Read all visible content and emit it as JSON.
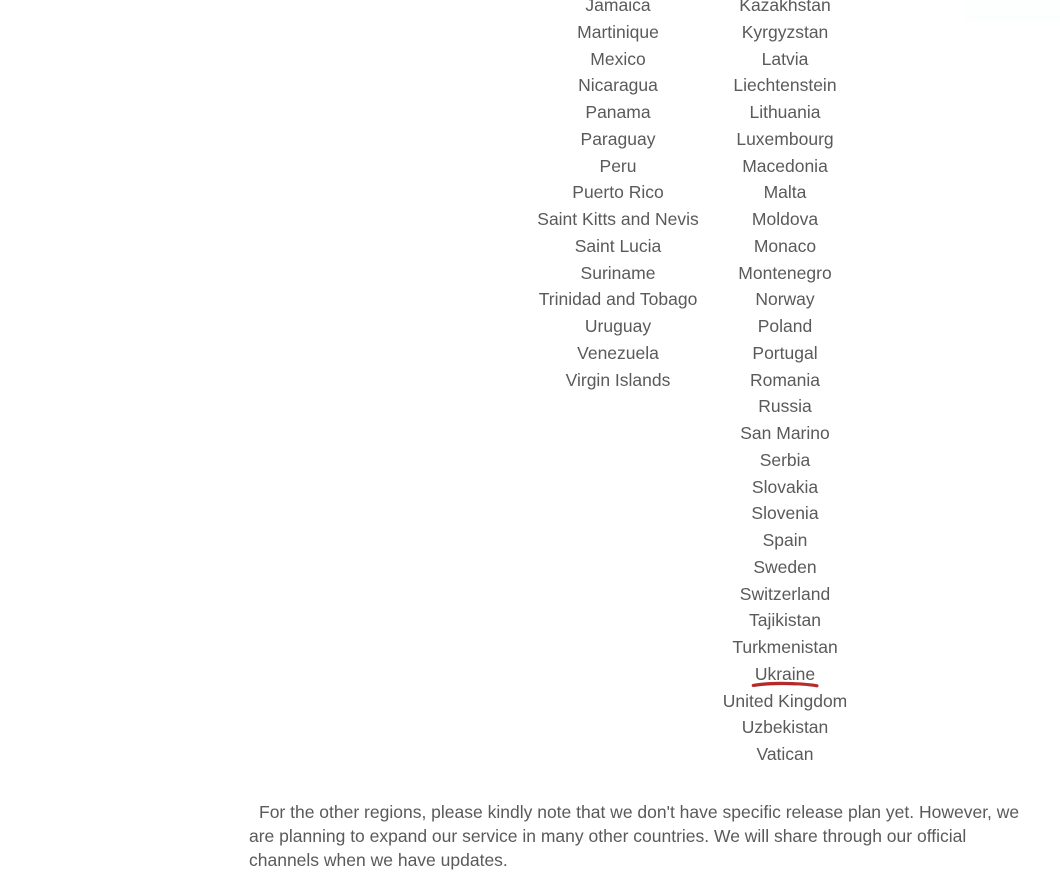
{
  "colors": {
    "text": "#5a5a5a",
    "background": "#ffffff",
    "marker_red": "#b22222"
  },
  "country_list": {
    "left_column": [
      "Jamaica",
      "Martinique",
      "Mexico",
      "Nicaragua",
      "Panama",
      "Paraguay",
      "Peru",
      "Puerto Rico",
      "Saint Kitts and Nevis",
      "Saint Lucia",
      "Suriname",
      "Trinidad and Tobago",
      "Uruguay",
      "Venezuela",
      "Virgin Islands"
    ],
    "right_column": [
      "Kazakhstan",
      "Kyrgyzstan",
      "Latvia",
      "Liechtenstein",
      "Lithuania",
      "Luxembourg",
      "Macedonia",
      "Malta",
      "Moldova",
      "Monaco",
      "Montenegro",
      "Norway",
      "Poland",
      "Portugal",
      "Romania",
      "Russia",
      "San Marino",
      "Serbia",
      "Slovakia",
      "Slovenia",
      "Spain",
      "Sweden",
      "Switzerland",
      "Tajikistan",
      "Turkmenistan",
      "Ukraine",
      "United Kingdom",
      "Uzbekistan",
      "Vatican"
    ],
    "highlighted_country": "Ukraine",
    "highlight_style": "red-marker-underline"
  },
  "note": {
    "text": "For the other regions, please kindly note that we don't have specific release plan yet. However, we are planning to expand our service in many other countries. We will share through our official channels when we have updates."
  }
}
